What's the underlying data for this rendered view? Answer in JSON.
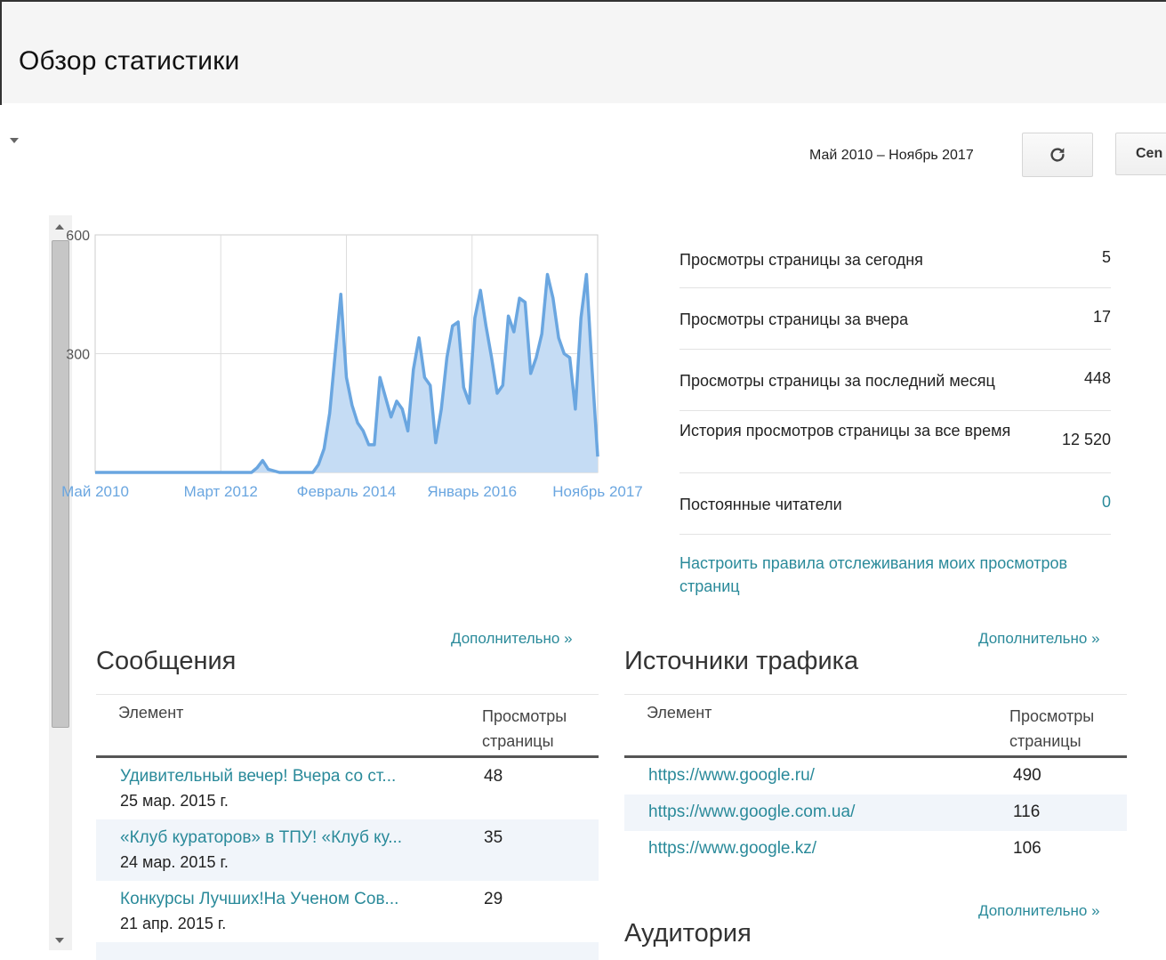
{
  "header": {
    "title": "Обзор статистики"
  },
  "toolbar": {
    "date_range": "Май 2010 – Ноябрь 2017",
    "refresh_icon": "refresh-icon",
    "send_label": "Сеn"
  },
  "chart_data": {
    "type": "area",
    "ylim": [
      0,
      600
    ],
    "y_ticks": [
      "600",
      "300"
    ],
    "x_labels": [
      "Май 2010",
      "Март 2012",
      "Февраль 2014",
      "Январь 2016",
      "Ноябрь 2017"
    ],
    "series": [
      {
        "color": "#6aa6e0",
        "points": [
          [
            "2010-05",
            0
          ],
          [
            "2011-01",
            0
          ],
          [
            "2011-09",
            0
          ],
          [
            "2012-06",
            0
          ],
          [
            "2012-09",
            0
          ],
          [
            "2012-10",
            12
          ],
          [
            "2012-11",
            30
          ],
          [
            "2012-12",
            8
          ],
          [
            "2013-02",
            0
          ],
          [
            "2013-08",
            0
          ],
          [
            "2013-09",
            20
          ],
          [
            "2013-10",
            60
          ],
          [
            "2013-11",
            150
          ],
          [
            "2013-12",
            300
          ],
          [
            "2014-01",
            450
          ],
          [
            "2014-02",
            240
          ],
          [
            "2014-03",
            170
          ],
          [
            "2014-04",
            125
          ],
          [
            "2014-05",
            105
          ],
          [
            "2014-06",
            70
          ],
          [
            "2014-07",
            70
          ],
          [
            "2014-08",
            240
          ],
          [
            "2014-09",
            190
          ],
          [
            "2014-10",
            140
          ],
          [
            "2014-11",
            180
          ],
          [
            "2014-12",
            160
          ],
          [
            "2015-01",
            105
          ],
          [
            "2015-02",
            260
          ],
          [
            "2015-03",
            340
          ],
          [
            "2015-04",
            240
          ],
          [
            "2015-05",
            220
          ],
          [
            "2015-06",
            75
          ],
          [
            "2015-07",
            160
          ],
          [
            "2015-08",
            290
          ],
          [
            "2015-09",
            370
          ],
          [
            "2015-10",
            380
          ],
          [
            "2015-11",
            215
          ],
          [
            "2015-12",
            175
          ],
          [
            "2016-01",
            390
          ],
          [
            "2016-02",
            460
          ],
          [
            "2016-03",
            370
          ],
          [
            "2016-04",
            290
          ],
          [
            "2016-05",
            200
          ],
          [
            "2016-06",
            220
          ],
          [
            "2016-07",
            395
          ],
          [
            "2016-08",
            355
          ],
          [
            "2016-09",
            440
          ],
          [
            "2016-10",
            430
          ],
          [
            "2016-11",
            250
          ],
          [
            "2016-12",
            290
          ],
          [
            "2017-01",
            350
          ],
          [
            "2017-02",
            500
          ],
          [
            "2017-03",
            440
          ],
          [
            "2017-04",
            340
          ],
          [
            "2017-05",
            300
          ],
          [
            "2017-06",
            290
          ],
          [
            "2017-07",
            160
          ],
          [
            "2017-08",
            390
          ],
          [
            "2017-09",
            500
          ],
          [
            "2017-10",
            260
          ],
          [
            "2017-11",
            40
          ]
        ]
      }
    ]
  },
  "stats": [
    {
      "label": "Просмотры страницы за сегодня",
      "value": "5"
    },
    {
      "label": "Просмотры страницы за вчера",
      "value": "17"
    },
    {
      "label": "Просмотры страницы за последний месяц",
      "value": "448"
    },
    {
      "label": "История просмотров страницы за все время",
      "value": "12 520"
    },
    {
      "label": "Постоянные читатели",
      "value": "0"
    }
  ],
  "tracking_link": "Настроить правила отслеживания моих просмотров страниц",
  "posts": {
    "title": "Сообщения",
    "more": "Дополнительно »",
    "col_element": "Элемент",
    "col_views_1": "Просмотры",
    "col_views_2": "страницы",
    "rows": [
      {
        "title": "Удивительный вечер! Вчера со ст...",
        "date": "25 мар. 2015 г.",
        "views": "48"
      },
      {
        "title": "«Клуб кураторов» в ТПУ! «Клуб ку...",
        "date": "24 мар. 2015 г.",
        "views": "35"
      },
      {
        "title": "Конкурсы Лучших!На Ученом Сов...",
        "date": "21 апр. 2015 г.",
        "views": "29"
      }
    ]
  },
  "traffic": {
    "title": "Источники трафика",
    "more": "Дополнительно »",
    "col_element": "Элемент",
    "col_views_1": "Просмотры",
    "col_views_2": "страницы",
    "rows": [
      {
        "url": "https://www.google.ru/",
        "views": "490"
      },
      {
        "url": "https://www.google.com.ua/",
        "views": "116"
      },
      {
        "url": "https://www.google.kz/",
        "views": "106"
      }
    ]
  },
  "audience": {
    "title": "Аудитория",
    "more": "Дополнительно »"
  }
}
